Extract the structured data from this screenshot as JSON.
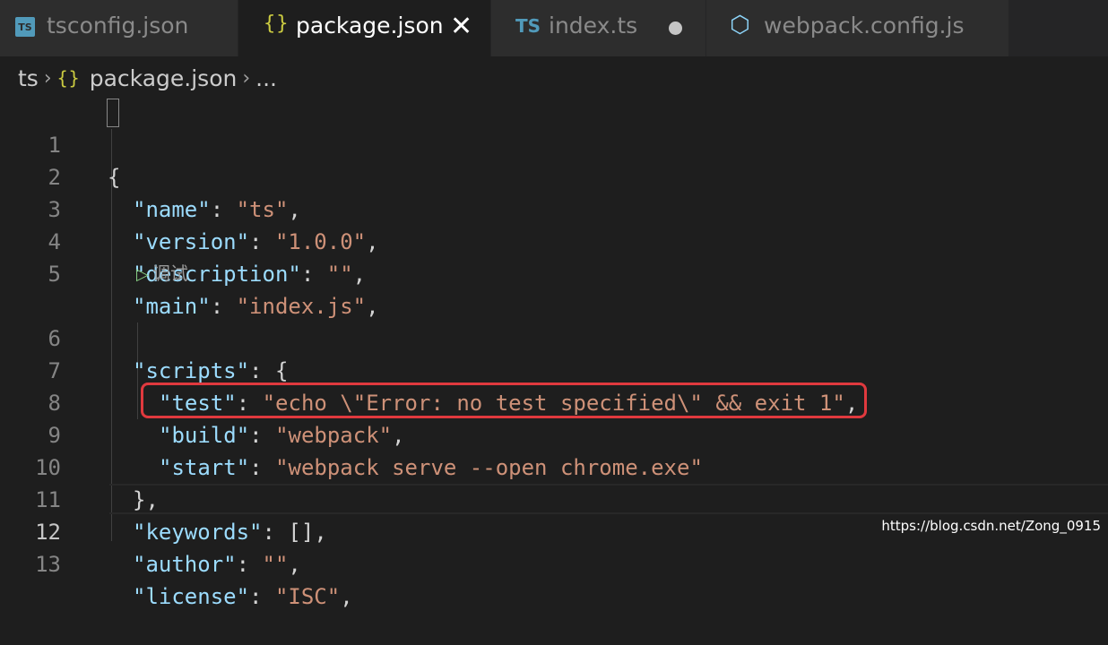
{
  "tabs": [
    {
      "label": "tsconfig.json",
      "icon": "typescript-config-icon",
      "icon_text": "TS"
    },
    {
      "label": "package.json",
      "icon": "json-braces-icon",
      "icon_text": "{}",
      "close": "✕"
    },
    {
      "label": "index.ts",
      "icon": "typescript-file-icon",
      "icon_text": "TS"
    },
    {
      "label": "webpack.config.js",
      "icon": "webpack-cube-icon",
      "icon_text": "⬡"
    }
  ],
  "breadcrumb": {
    "folder": "ts",
    "file_icon": "{}",
    "file": "package.json",
    "more": "..."
  },
  "codelens": {
    "label": "调试",
    "play": "▷"
  },
  "line_numbers": [
    "1",
    "2",
    "3",
    "4",
    "5",
    "6",
    "7",
    "8",
    "9",
    "10",
    "11",
    "12",
    "13"
  ],
  "code": {
    "l1": {
      "brace": "{"
    },
    "l2": {
      "key": "\"name\"",
      "value": "\"ts\""
    },
    "l3": {
      "key": "\"version\"",
      "value": "\"1.0.0\""
    },
    "l4": {
      "key": "\"description\"",
      "value": "\"\""
    },
    "l5": {
      "key": "\"main\"",
      "value": "\"index.js\""
    },
    "l6": {
      "key": "\"scripts\"",
      "brace": "{"
    },
    "l7": {
      "key": "\"test\"",
      "value": "\"echo \\\"Error: no test specified\\\" && exit 1\""
    },
    "l8": {
      "key": "\"build\"",
      "value": "\"webpack\""
    },
    "l9": {
      "key": "\"start\"",
      "value": "\"webpack serve --open chrome.exe\""
    },
    "l10": {
      "close": "},"
    },
    "l11": {
      "key": "\"keywords\"",
      "value": "[]"
    },
    "l12": {
      "key": "\"author\"",
      "value": "\"\""
    },
    "l13": {
      "key": "\"license\"",
      "value": "\"ISC\""
    }
  },
  "watermark": "https://blog.csdn.net/Zong_0915",
  "colors": {
    "key": "#9cdcfe",
    "string": "#ce9178",
    "highlight_box": "#e0393e"
  }
}
